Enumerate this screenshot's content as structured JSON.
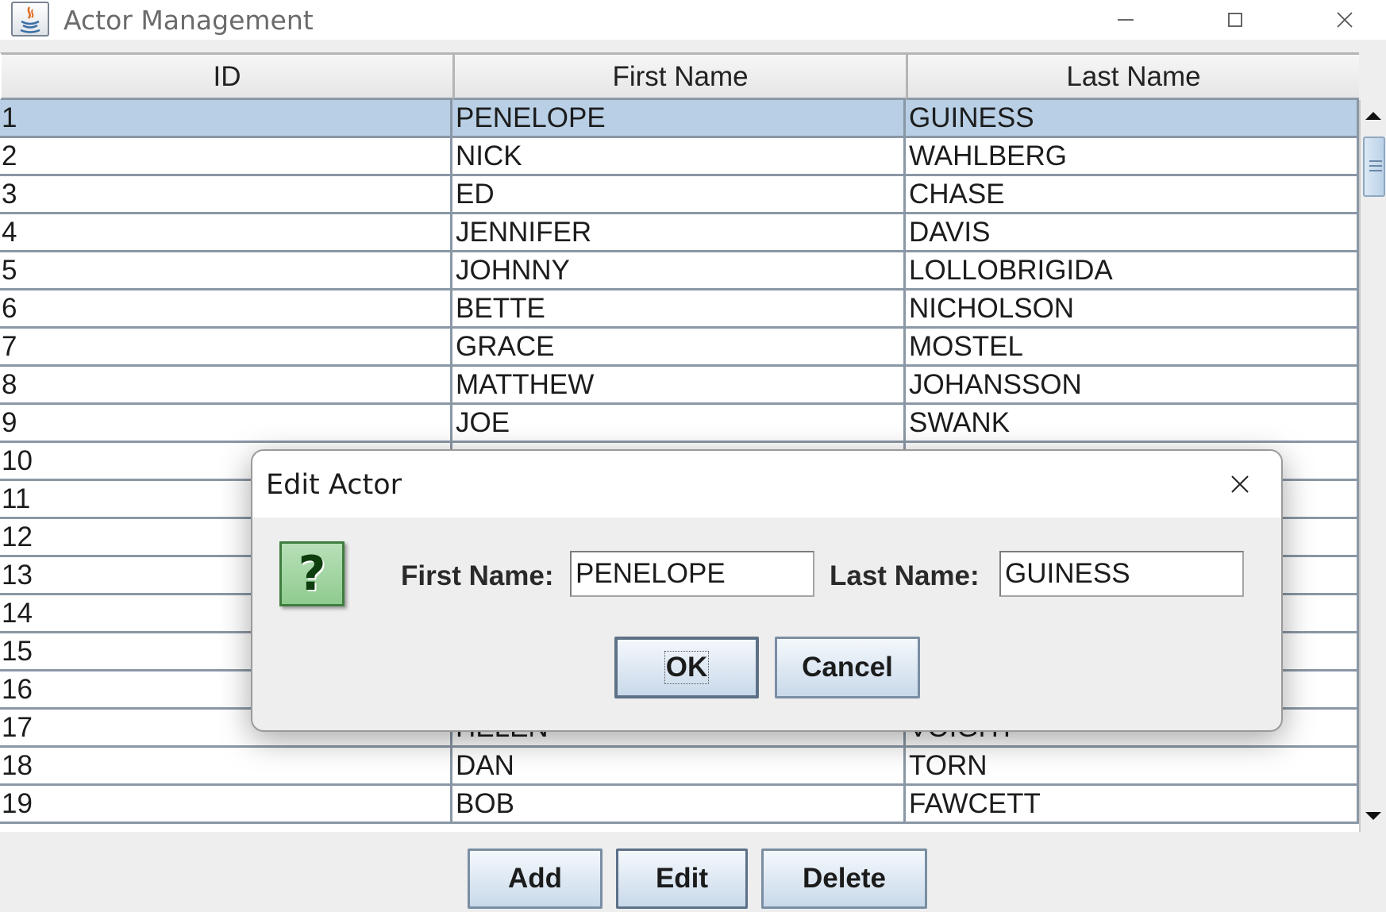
{
  "window": {
    "title": "Actor Management",
    "icon": "java-cup-icon",
    "controls": [
      "minimize-icon",
      "maximize-icon",
      "close-icon"
    ]
  },
  "table": {
    "columns": [
      "ID",
      "First Name",
      "Last Name"
    ],
    "selected_row": 0,
    "rows": [
      {
        "id": "1",
        "first": "PENELOPE",
        "last": "GUINESS"
      },
      {
        "id": "2",
        "first": "NICK",
        "last": "WAHLBERG"
      },
      {
        "id": "3",
        "first": "ED",
        "last": "CHASE"
      },
      {
        "id": "4",
        "first": "JENNIFER",
        "last": "DAVIS"
      },
      {
        "id": "5",
        "first": "JOHNNY",
        "last": "LOLLOBRIGIDA"
      },
      {
        "id": "6",
        "first": "BETTE",
        "last": "NICHOLSON"
      },
      {
        "id": "7",
        "first": "GRACE",
        "last": "MOSTEL"
      },
      {
        "id": "8",
        "first": "MATTHEW",
        "last": "JOHANSSON"
      },
      {
        "id": "9",
        "first": "JOE",
        "last": "SWANK"
      },
      {
        "id": "10",
        "first": "",
        "last": ""
      },
      {
        "id": "11",
        "first": "",
        "last": ""
      },
      {
        "id": "12",
        "first": "",
        "last": ""
      },
      {
        "id": "13",
        "first": "",
        "last": ""
      },
      {
        "id": "14",
        "first": "",
        "last": ""
      },
      {
        "id": "15",
        "first": "",
        "last": ""
      },
      {
        "id": "16",
        "first": "",
        "last": ""
      },
      {
        "id": "17",
        "first": "HELEN",
        "last": "VOIGHT"
      },
      {
        "id": "18",
        "first": "DAN",
        "last": "TORN"
      },
      {
        "id": "19",
        "first": "BOB",
        "last": "FAWCETT"
      }
    ]
  },
  "buttons": {
    "add": "Add",
    "edit": "Edit",
    "delete": "Delete"
  },
  "dialog": {
    "title": "Edit Actor",
    "icon": "question-icon",
    "icon_glyph": "?",
    "first_name_label": "First Name:",
    "first_name_value": "PENELOPE",
    "last_name_label": "Last Name:",
    "last_name_value": "GUINESS",
    "ok": "OK",
    "cancel": "Cancel"
  },
  "colors": {
    "selection": "#b8cfe5",
    "icon_green": "#8fcb8f"
  }
}
